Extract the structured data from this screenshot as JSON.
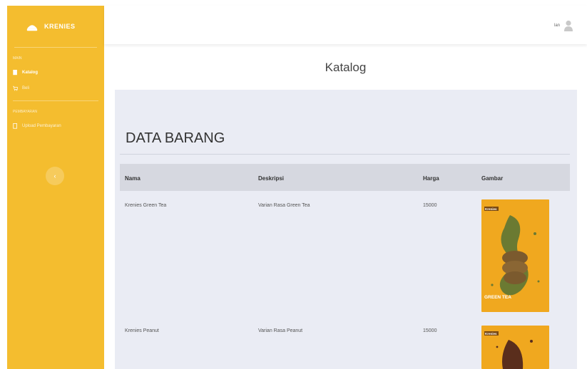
{
  "sidebar": {
    "brand": "KRENIES",
    "section_label": "MAIN",
    "items": [
      {
        "label": "Katalog",
        "icon": "document-icon",
        "active": true
      },
      {
        "label": "Beli",
        "icon": "cart-icon",
        "active": false
      }
    ],
    "section2_label": "PEMBAYARAN",
    "items2": [
      {
        "label": "Upload Pembayaran",
        "icon": "upload-icon"
      }
    ],
    "toggle_symbol": "‹"
  },
  "topbar": {
    "user_name": "lan"
  },
  "page": {
    "title": "Katalog"
  },
  "card": {
    "title": "DATA BARANG",
    "columns": [
      "Nama",
      "Deskripsi",
      "Harga",
      "Gambar"
    ],
    "rows": [
      {
        "nama": "Krenies Green Tea",
        "deskripsi": "Varian Rasa Green Tea",
        "harga": "15000",
        "poster_label": "GREEN TEA",
        "poster_brand": "Krenies"
      },
      {
        "nama": "Krenies Peanut",
        "deskripsi": "Varian Rasa Peanut",
        "harga": "15000",
        "poster_brand": "Krenies"
      }
    ]
  },
  "colors": {
    "sidebar": "#f4bd2f",
    "card_bg": "#eaecf4",
    "table_header": "#d6d8e0"
  }
}
